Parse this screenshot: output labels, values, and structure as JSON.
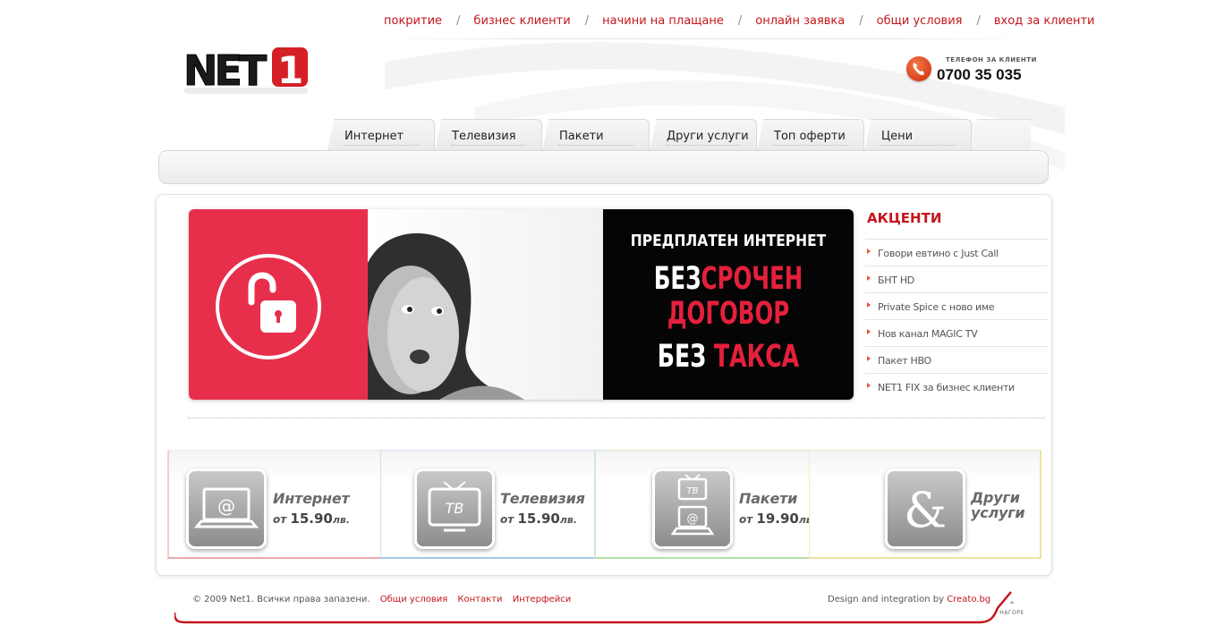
{
  "top_links": [
    "покритие",
    "бизнес клиенти",
    "начини на плащане",
    "онлайн заявка",
    "общи условия",
    "вход за клиенти"
  ],
  "top_link_separator": "/",
  "logo": {
    "text": "NET",
    "digit": "1"
  },
  "phone": {
    "label": "ТЕЛЕФОН ЗА КЛИЕНТИ",
    "number": "0700 35 035",
    "icon": "phone-icon"
  },
  "nav_tabs": [
    "Интернет",
    "Телевизия",
    "Пакети",
    "Други услуги",
    "Топ оферти",
    "Цени"
  ],
  "banner": {
    "line1": "ПРЕДПЛАТЕН ИНТЕРНЕТ",
    "line2_white": "БЕЗ",
    "line2_red": "СРОЧЕН",
    "line3": "ДОГОВОР",
    "line4_white": "БЕЗ",
    "line4_red": "ТАКСА",
    "icon": "unlocked-padlock-icon"
  },
  "accents": {
    "title": "АКЦЕНТИ",
    "items": [
      "Говори евтино с Just Call",
      "БНТ HD",
      "Private Spice с ново име",
      "Нов канал MAGIC TV",
      "Пакет HBO",
      "NET1 FIX за бизнес клиенти"
    ]
  },
  "services": [
    {
      "title": "Интернет",
      "prefix": "от",
      "price": "15.90",
      "unit": "лв.",
      "icon": "laptop-icon",
      "color": "#e8a9a9"
    },
    {
      "title": "Телевизия",
      "prefix": "от",
      "price": "15.90",
      "unit": "лв.",
      "icon": "tv-icon",
      "color": "#a9c6e8"
    },
    {
      "title": "Пакети",
      "prefix": "от",
      "price": "19.90",
      "unit": "лв.",
      "icon": "tv-laptop-icon",
      "color": "#b6e0a3"
    },
    {
      "title": "Други услуги",
      "title_line1": "Други",
      "title_line2": "услуги",
      "icon": "ampersand-icon",
      "color": "#eee2a0"
    }
  ],
  "footer": {
    "copyright": "© 2009 Net1. Всички права запазени.",
    "links": [
      "Общи условия",
      "Контакти",
      "Интерфейси"
    ],
    "design_text": "Design and integration by",
    "design_link": "Creato.bg",
    "top_label": "НАГОРЕ"
  },
  "colors": {
    "accent_red": "#c4161c",
    "banner_red": "#e72f4c"
  }
}
